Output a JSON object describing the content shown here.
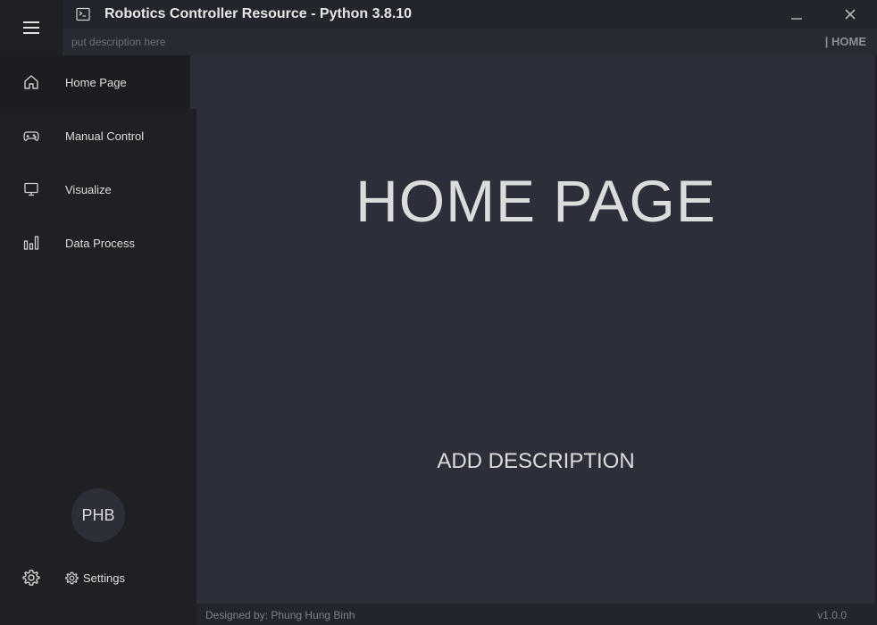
{
  "window": {
    "title": "Robotics Controller Resource - Python 3.8.10"
  },
  "subbar": {
    "description": "put description here",
    "page_label": "| HOME"
  },
  "sidebar": {
    "items": [
      {
        "label": "Home Page",
        "icon": "home-icon",
        "active": true
      },
      {
        "label": "Manual Control",
        "icon": "gamepad-icon",
        "active": false
      },
      {
        "label": "Visualize",
        "icon": "monitor-icon",
        "active": false
      },
      {
        "label": "Data Process",
        "icon": "bar-chart-icon",
        "active": false
      }
    ],
    "avatar_initials": "PHB",
    "settings_label": "Settings"
  },
  "content": {
    "title": "HOME PAGE",
    "description": "ADD DESCRIPTION"
  },
  "footer": {
    "designer": "Designed by: Phung Hung Binh",
    "version": "v1.0.0"
  },
  "colors": {
    "sidebar_bg": "#1e2024",
    "content_bg": "#2c2f39",
    "titlebar_bg": "#22252b",
    "text": "#dcdcdc"
  }
}
